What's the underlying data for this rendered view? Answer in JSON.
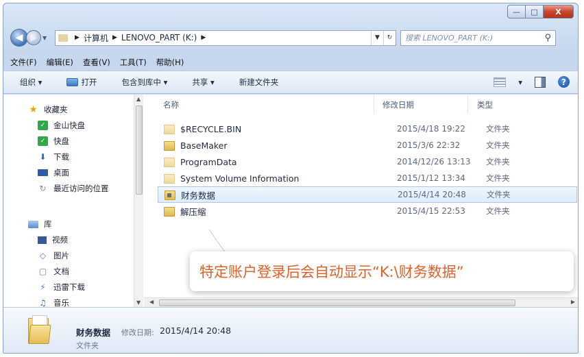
{
  "window": {
    "minimize_glyph": "—",
    "maximize_glyph": "□",
    "close_glyph": "X"
  },
  "address": {
    "root": "计算机",
    "drive": "LENOVO_PART (K:)",
    "search_placeholder": "搜索 LENOVO_PART (K:)"
  },
  "menu": [
    "文件(F)",
    "编辑(E)",
    "查看(V)",
    "工具(T)",
    "帮助(H)"
  ],
  "toolbar": {
    "organize": "组织 ▾",
    "open": "打开",
    "include": "包含到库中 ▾",
    "share": "共享 ▾",
    "new_folder": "新建文件夹",
    "view_drop": "▾"
  },
  "nav": {
    "favorites": "收藏夹",
    "items": [
      "金山快盘",
      "快盘",
      "下载",
      "桌面",
      "最近访问的位置"
    ],
    "libraries": "库",
    "lib_items": [
      "视频",
      "图片",
      "文档",
      "迅雷下载",
      "音乐"
    ]
  },
  "columns": {
    "name": "名称",
    "date": "修改日期",
    "type": "类型"
  },
  "files": [
    {
      "name": "$RECYCLE.BIN",
      "date": "2015/4/18 19:22",
      "type": "文件夹"
    },
    {
      "name": "BaseMaker",
      "date": "2015/3/6 22:32",
      "type": "文件夹"
    },
    {
      "name": "ProgramData",
      "date": "2014/12/26 13:13",
      "type": "文件夹"
    },
    {
      "name": "System Volume Information",
      "date": "2015/1/12 13:34",
      "type": "文件夹"
    },
    {
      "name": "财务数据",
      "date": "2015/4/14 20:48",
      "type": "文件夹"
    },
    {
      "name": "解压缩",
      "date": "2015/4/15 22:53",
      "type": "文件夹"
    }
  ],
  "callout": "特定账户登录后会自动显示“K:\\财务数据”",
  "details": {
    "name": "财务数据",
    "modified_label": "修改日期:",
    "modified": "2015/4/14 20:48",
    "type": "文件夹"
  },
  "colors": {
    "callout_text": "#e0612a",
    "selection": "#dcebfc"
  }
}
